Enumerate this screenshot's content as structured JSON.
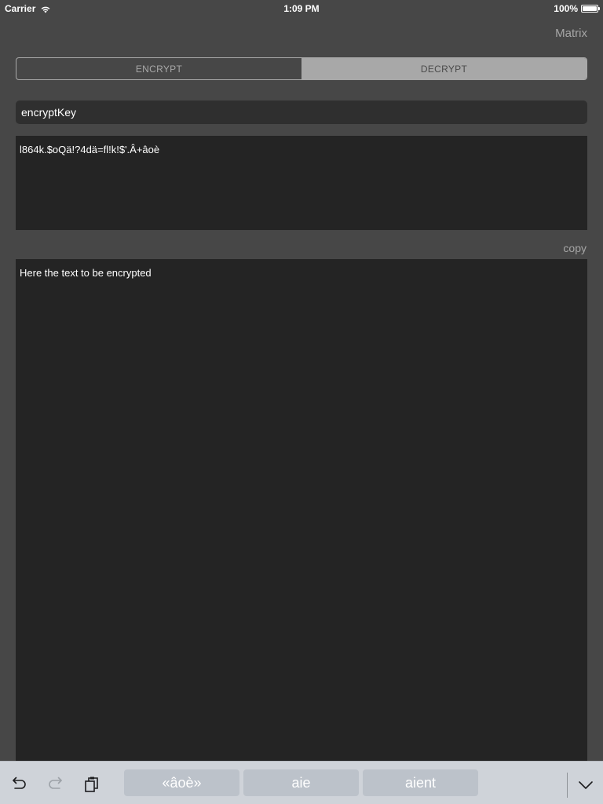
{
  "status_bar": {
    "carrier": "Carrier",
    "time": "1:09 PM",
    "battery": "100%",
    "battery_level": 1.0
  },
  "nav": {
    "right_button": "Matrix"
  },
  "segmented": {
    "encrypt_label": "ENCRYPT",
    "decrypt_label": "DECRYPT",
    "selected": "DECRYPT"
  },
  "key_field": {
    "value": "encryptKey"
  },
  "output": {
    "value": "l864k.$oQä!?4dä=fl!k!$'.Â+âoè"
  },
  "copy_button": "copy",
  "input": {
    "value": "Here the text to be encrypted"
  },
  "keyboard_bar": {
    "icons": [
      "undo-icon",
      "redo-icon",
      "paste-icon",
      "chevron-down-icon"
    ],
    "suggestions": [
      "«âoè»",
      "aie",
      "aient"
    ]
  },
  "colors": {
    "background": "#474747",
    "field": "#2f2f2f",
    "textarea": "#242424",
    "segment_selected": "#a8a8a8",
    "keyboard_bar": "#cfd3d9",
    "suggestion": "#bcc2ca"
  }
}
